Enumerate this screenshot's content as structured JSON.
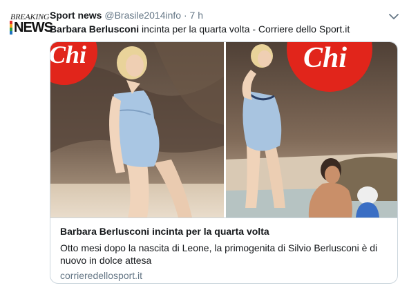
{
  "tweet": {
    "author_name": "Sport news",
    "handle": "@Brasile2014info",
    "separator": "·",
    "time": "7 h",
    "text_bold": "Barbara Berlusconi",
    "text_rest": " incinta per la quarta volta - Corriere dello Sport.it"
  },
  "avatar": {
    "top_text": "BREAKING",
    "bottom_text": "NEWS",
    "stripe_colors": [
      "#e4322b",
      "#f3a31d",
      "#2f9e44",
      "#1e73be"
    ]
  },
  "card": {
    "photo_logo_left": "Chi",
    "photo_logo_right": "Chi",
    "title": "Barbara Berlusconi incinta per la quarta volta",
    "description": "Otto mesi dopo la nascita di Leone, la primogenita di Silvio Berlusconi è di nuovo in dolce attesa",
    "domain": "corrieredellosport.it"
  },
  "colors": {
    "text": "#14171a",
    "muted": "#657786",
    "border": "#ccd6dd",
    "logo_red": "#e1251b"
  },
  "icons": {
    "caret": "chevron-down-icon"
  }
}
